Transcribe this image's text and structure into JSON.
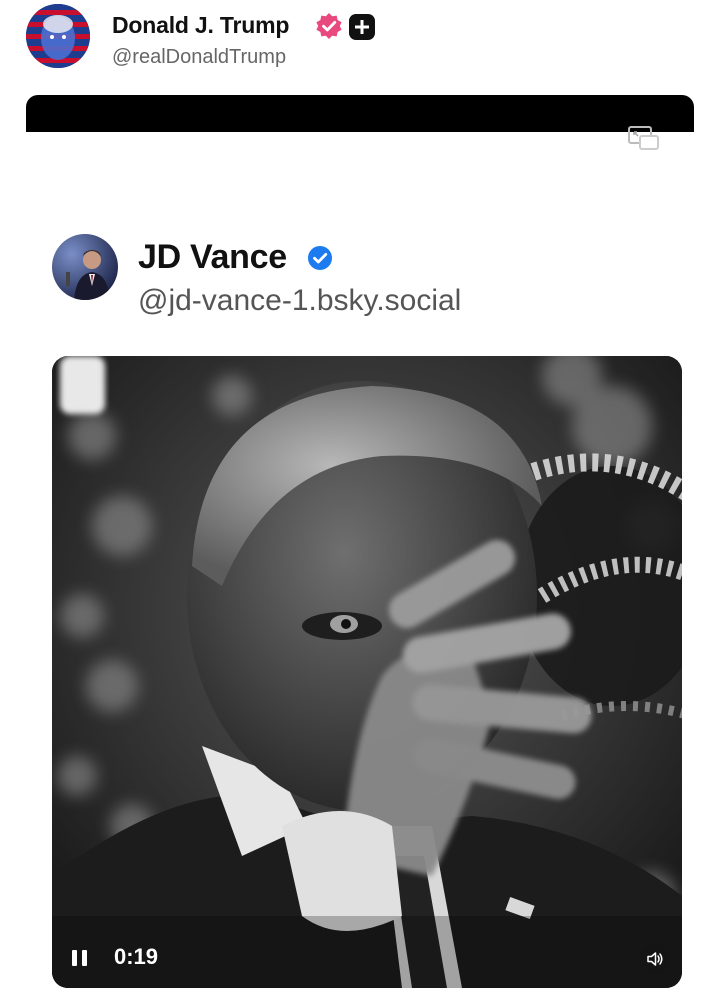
{
  "post": {
    "author_name": "Donald J. Trump",
    "author_handle": "@realDonaldTrump",
    "verified_badge_icon": "verified-check-icon",
    "verified_badge_color": "#e84a7f",
    "plus_badge_icon": "plus-icon"
  },
  "media": {
    "pip_icon": "picture-in-picture-icon"
  },
  "quoted_post": {
    "author_name": "JD Vance",
    "author_handle": "@jd-vance-1.bsky.social",
    "verified_badge_icon": "verified-check-icon",
    "verified_badge_color": "#1d7bf0",
    "video": {
      "time": "0:19",
      "state": "playing",
      "pause_icon": "pause-icon",
      "volume_icon": "volume-icon"
    }
  }
}
